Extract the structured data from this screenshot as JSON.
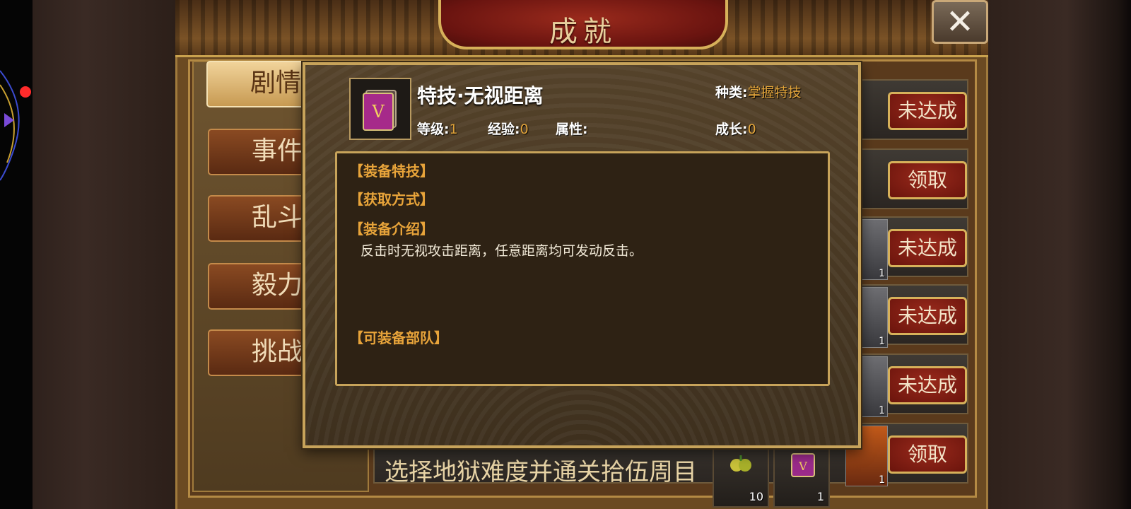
{
  "title": "成就",
  "close_label": "✕",
  "tabs": [
    {
      "label": "剧情",
      "active": true
    },
    {
      "label": "事件",
      "active": false
    },
    {
      "label": "乱斗",
      "active": false
    },
    {
      "label": "毅力",
      "active": false
    },
    {
      "label": "挑战",
      "active": false
    }
  ],
  "rows": [
    {
      "button": "未达成",
      "thumb_qty": ""
    },
    {
      "button": "领取",
      "thumb_qty": ""
    },
    {
      "button": "未达成",
      "thumb_qty": "1"
    },
    {
      "button": "未达成",
      "thumb_qty": "1"
    },
    {
      "button": "未达成",
      "thumb_qty": "1"
    },
    {
      "button": "领取",
      "thumb_qty": "1"
    }
  ],
  "bottom_row": {
    "text": "选择地狱难度并通关拾伍周目",
    "rewards": [
      {
        "icon": "fruit-icon",
        "qty": "10"
      },
      {
        "icon": "skill-book-icon",
        "qty": "1"
      }
    ]
  },
  "popup": {
    "item_name": "特技·无视距离",
    "icon_letter": "V",
    "stats": {
      "kind_label": "种类:",
      "kind_value": "掌握特技",
      "level_label": "等级:",
      "level_value": "1",
      "exp_label": "经验:",
      "exp_value": "0",
      "attr_label": "属性:",
      "growth_label": "成长:",
      "growth_value": "0"
    },
    "sections": {
      "equip_skill": "【装备特技】",
      "obtain": "【获取方式】",
      "intro": "【装备介绍】",
      "intro_text": "反击时无视攻击距离，任意距离均可发动反击。",
      "units": "【可装备部队】"
    }
  },
  "colors": {
    "accent_gold": "#e2a43a",
    "button_red": "#8a2216",
    "frame_gold": "#c7a35a"
  }
}
